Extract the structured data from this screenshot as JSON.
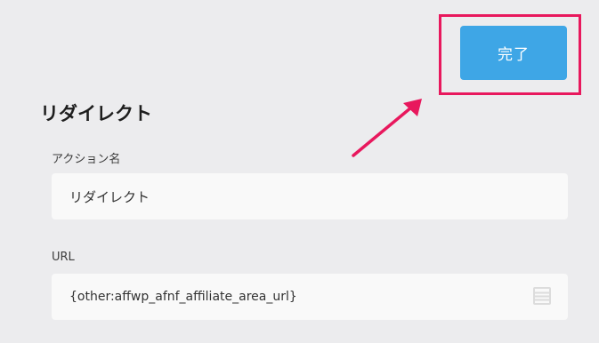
{
  "header": {
    "done_label": "完了"
  },
  "section": {
    "title": "リダイレクト"
  },
  "fields": {
    "action_name": {
      "label": "アクション名",
      "value": "リダイレクト"
    },
    "url": {
      "label": "URL",
      "value": "{other:affwp_afnf_affiliate_area_url}"
    }
  },
  "icons": {
    "merge_tag": "list-icon"
  },
  "colors": {
    "accent": "#3ea6e6",
    "annotation": "#e8185d",
    "background": "#ececee",
    "field_background": "#f9f9f9"
  }
}
